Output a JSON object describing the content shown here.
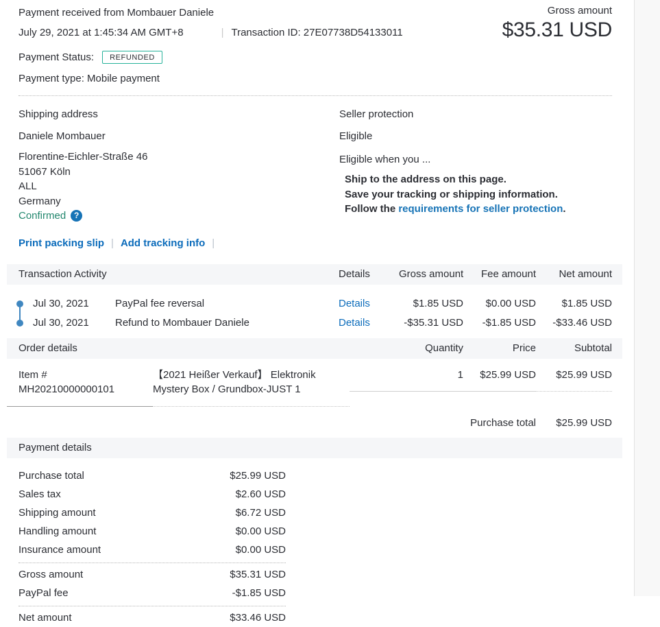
{
  "ui": {
    "separator": "|"
  },
  "colors": {
    "link_blue": "#0c6cbb",
    "confirmed_green": "#23876e",
    "badge_border_teal": "#26b29a",
    "timeline_dot_blue": "#4087c0",
    "band_background": "#f5f6f8"
  },
  "header": {
    "title": "Payment received from Mombauer Daniele",
    "date": "July 29, 2021 at 1:45:34 AM GMT+8",
    "transaction_id_label": "Transaction ID:",
    "transaction_id": "27E07738D54133011",
    "payment_status_label": "Payment Status:",
    "payment_status_badge": "REFUNDED",
    "payment_type": "Payment type: Mobile payment",
    "gross_amount_label": "Gross amount",
    "gross_amount_value": "$35.31 USD"
  },
  "shipping": {
    "heading": "Shipping address",
    "recipient": "Daniele Mombauer",
    "address_lines": [
      "Florentine-Eichler-Straße 46",
      "51067 Köln",
      "ALL",
      "Germany"
    ],
    "confirmed_label": "Confirmed",
    "help_icon": "?",
    "print_packing_slip": "Print packing slip",
    "add_tracking_info": "Add tracking info"
  },
  "seller_protection": {
    "heading": "Seller protection",
    "status": "Eligible",
    "subheading": "Eligible when you ...",
    "item1": "Ship to the address on this page.",
    "item2": "Save your tracking or shipping information.",
    "item3_prefix": "Follow the ",
    "item3_link": "requirements for seller protection",
    "item3_suffix": "."
  },
  "transaction_activity": {
    "heading": "Transaction Activity",
    "col_details": "Details",
    "col_gross": "Gross amount",
    "col_fee": "Fee amount",
    "col_net": "Net amount",
    "details_label": "Details",
    "rows": [
      {
        "date": "Jul 30, 2021",
        "description": "PayPal fee reversal",
        "gross": "$1.85 USD",
        "fee": "$0.00 USD",
        "net": "$1.85 USD"
      },
      {
        "date": "Jul 30, 2021",
        "description": "Refund to Mombauer Daniele",
        "gross": "-$35.31 USD",
        "fee": "-$1.85 USD",
        "net": "-$33.46 USD"
      }
    ]
  },
  "order_details": {
    "heading": "Order details",
    "col_quantity": "Quantity",
    "col_price": "Price",
    "col_subtotal": "Subtotal",
    "item_number_label": "Item #",
    "item_number": "MH20210000000101",
    "item_description": "【2021 Heißer Verkauf】 Elektronik Mystery Box / Grundbox-JUST 1",
    "item_quantity": "1",
    "item_price": "$25.99 USD",
    "item_subtotal": "$25.99 USD",
    "purchase_total_label": "Purchase total",
    "purchase_total_value": "$25.99 USD"
  },
  "payment_details": {
    "heading": "Payment details",
    "rows": [
      {
        "label": "Purchase total",
        "value": "$25.99 USD"
      },
      {
        "label": "Sales tax",
        "value": "$2.60 USD"
      },
      {
        "label": "Shipping amount",
        "value": "$6.72 USD"
      },
      {
        "label": "Handling amount",
        "value": "$0.00 USD"
      },
      {
        "label": "Insurance amount",
        "value": "$0.00 USD"
      },
      {
        "label": "Gross amount",
        "value": "$35.31 USD"
      },
      {
        "label": "PayPal fee",
        "value": "-$1.85 USD"
      },
      {
        "label": "Net amount",
        "value": "$33.46 USD"
      }
    ]
  }
}
